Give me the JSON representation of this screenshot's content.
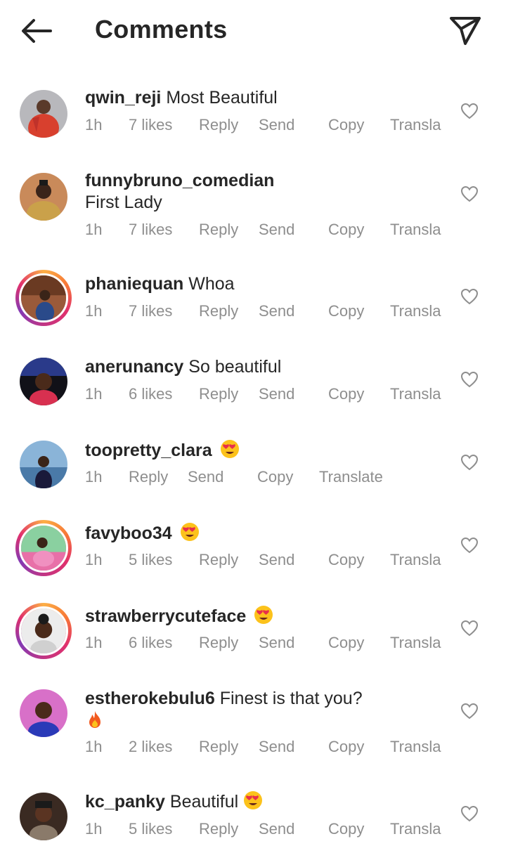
{
  "header": {
    "title": "Comments"
  },
  "comments": [
    {
      "username": "qwin_reji",
      "text": "Most Beautiful",
      "time": "1h",
      "likes": "7 likes",
      "reply": "Reply",
      "send": "Send",
      "copy": "Copy",
      "translate": "Transla",
      "avatar_color": "#d8402e"
    },
    {
      "username": "funnybruno_comedian",
      "text": "First Lady",
      "time": "1h",
      "likes": "7 likes",
      "reply": "Reply",
      "send": "Send",
      "copy": "Copy",
      "translate": "Transla",
      "avatar_color": "#c9a050"
    },
    {
      "username": "phaniequan",
      "text": "Whoa",
      "time": "1h",
      "likes": "7 likes",
      "reply": "Reply",
      "send": "Send",
      "copy": "Copy",
      "translate": "Transla",
      "avatar_color": "#8a4a2a"
    },
    {
      "username": "anerunancy",
      "text": "So beautiful",
      "time": "1h",
      "likes": "6 likes",
      "reply": "Reply",
      "send": "Send",
      "copy": "Copy",
      "translate": "Transla",
      "avatar_color": "#1a1a2a"
    },
    {
      "username": "toopretty_clara",
      "text": "",
      "time": "1h",
      "reply": "Reply",
      "send": "Send",
      "copy": "Copy",
      "translate": "Translate",
      "avatar_color": "#6ea0c8"
    },
    {
      "username": "favyboo34",
      "text": "",
      "time": "1h",
      "likes": "5 likes",
      "reply": "Reply",
      "send": "Send",
      "copy": "Copy",
      "translate": "Transla",
      "avatar_color": "#e06aa0"
    },
    {
      "username": "strawberrycuteface",
      "text": "",
      "time": "1h",
      "likes": "6 likes",
      "reply": "Reply",
      "send": "Send",
      "copy": "Copy",
      "translate": "Transla",
      "avatar_color": "#d8d8d8"
    },
    {
      "username": "estherokebulu6",
      "text": "Finest is that you?",
      "time": "1h",
      "likes": "2 likes",
      "reply": "Reply",
      "send": "Send",
      "copy": "Copy",
      "translate": "Transla",
      "avatar_color": "#c04a9a"
    },
    {
      "username": "kc_panky",
      "text": "Beautiful",
      "time": "1h",
      "likes": "5 likes",
      "reply": "Reply",
      "send": "Send",
      "copy": "Copy",
      "translate": "Transla",
      "avatar_color": "#6a4a3a"
    }
  ]
}
